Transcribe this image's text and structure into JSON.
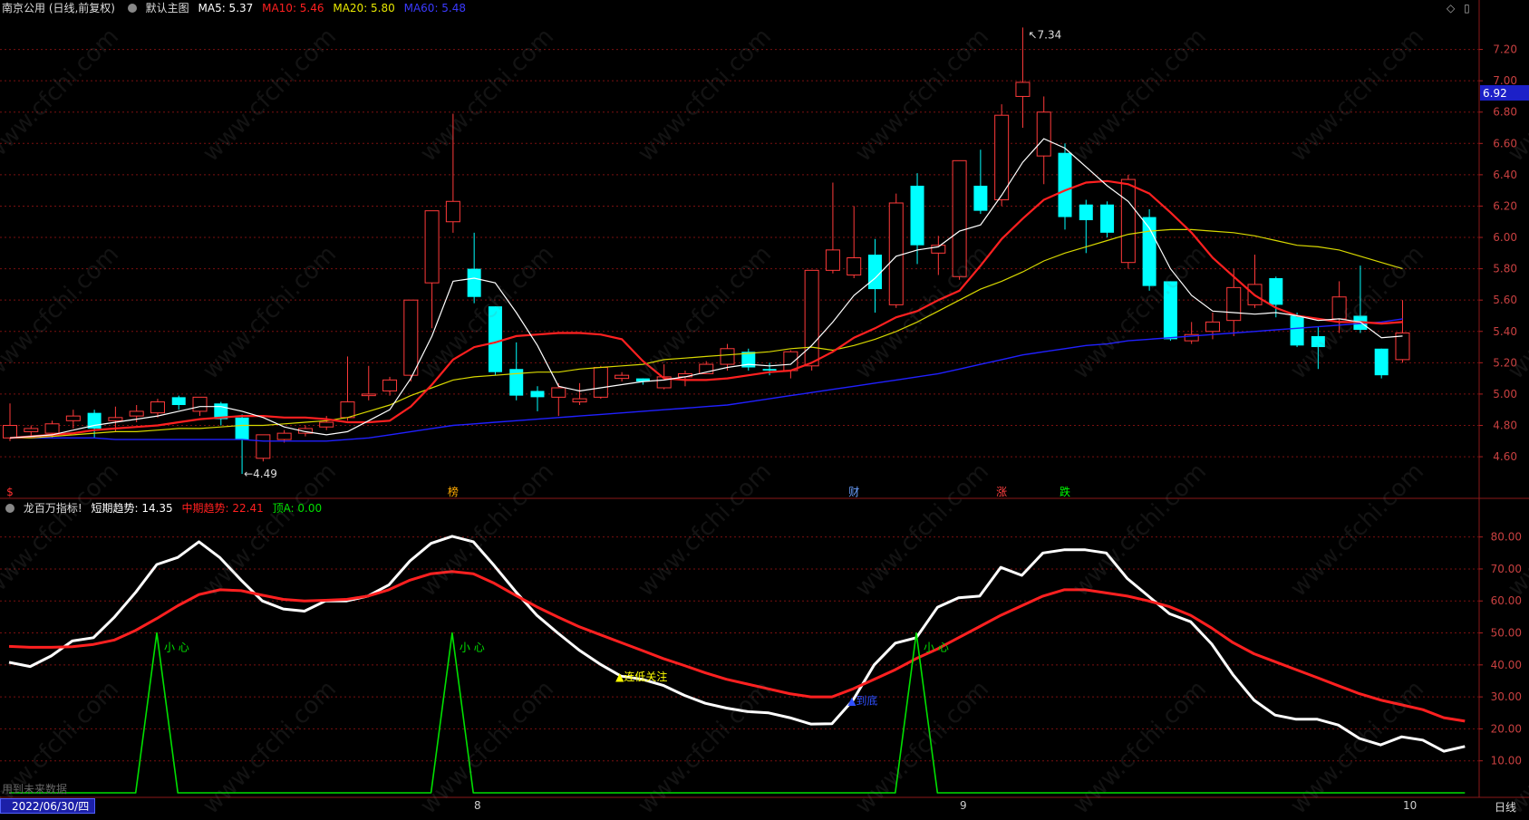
{
  "header": {
    "stock_label": "南京公用 (日线,前复权)",
    "chart_name": "默认主图",
    "ma5": "MA5: 5.37",
    "ma10": "MA10: 5.46",
    "ma20": "MA20: 5.80",
    "ma60": "MA60: 5.48",
    "icon_diamond": "◇",
    "icon_menu": "▯"
  },
  "indicator_header": {
    "name": "龙百万指标!",
    "short": "短期趋势: 14.35",
    "mid": "中期趋势: 22.41",
    "top": "顶A: 0.00"
  },
  "colors": {
    "up": "#ff3a3a",
    "down": "#00ffff",
    "ma5": "#ffffff",
    "ma10": "#ff2020",
    "ma20": "#d8d800",
    "ma60": "#2020ff",
    "grid": "#7a1010",
    "signal": "#00e000"
  },
  "bottom_bar": {
    "date": "2022/06/30/四",
    "month8": "8",
    "month9": "9",
    "month10": "10",
    "period": "日线",
    "future_note": "用到未来数据"
  },
  "watermark": "www.cfchi.com",
  "chart_data": [
    {
      "type": "candlestick",
      "ylim": [
        4.45,
        7.4
      ],
      "y_ticks": [
        "7.20",
        "7.00",
        "6.80",
        "6.60",
        "6.40",
        "6.20",
        "6.00",
        "5.80",
        "5.60",
        "5.40",
        "5.20",
        "5.00",
        "4.80",
        "4.60"
      ],
      "current_price_label": "6.92",
      "high_label": "7.34",
      "low_label": "4.49",
      "event_markers": [
        {
          "index": 0,
          "text": "$",
          "color": "#ff3030"
        },
        {
          "index": 21,
          "text": "榜",
          "color": "#ffaa00"
        },
        {
          "index": 40,
          "text": "财",
          "color": "#6aa0ff"
        },
        {
          "index": 47,
          "text": "涨",
          "color": "#ff4040"
        },
        {
          "index": 50,
          "text": "跌",
          "color": "#00ff00"
        }
      ],
      "candles": [
        {
          "o": 4.72,
          "c": 4.8,
          "h": 4.94,
          "l": 4.7
        },
        {
          "o": 4.76,
          "c": 4.78,
          "h": 4.8,
          "l": 4.73
        },
        {
          "o": 4.75,
          "c": 4.81,
          "h": 4.83,
          "l": 4.72
        },
        {
          "o": 4.83,
          "c": 4.86,
          "h": 4.9,
          "l": 4.78
        },
        {
          "o": 4.88,
          "c": 4.78,
          "h": 4.9,
          "l": 4.72
        },
        {
          "o": 4.83,
          "c": 4.85,
          "h": 4.92,
          "l": 4.76
        },
        {
          "o": 4.86,
          "c": 4.89,
          "h": 4.93,
          "l": 4.82
        },
        {
          "o": 4.88,
          "c": 4.95,
          "h": 4.97,
          "l": 4.85
        },
        {
          "o": 4.98,
          "c": 4.93,
          "h": 4.99,
          "l": 4.9
        },
        {
          "o": 4.89,
          "c": 4.98,
          "h": 4.98,
          "l": 4.86
        },
        {
          "o": 4.94,
          "c": 4.84,
          "h": 4.95,
          "l": 4.8
        },
        {
          "o": 4.85,
          "c": 4.71,
          "h": 4.87,
          "l": 4.49
        },
        {
          "o": 4.59,
          "c": 4.74,
          "h": 4.74,
          "l": 4.57
        },
        {
          "o": 4.71,
          "c": 4.75,
          "h": 4.77,
          "l": 4.69
        },
        {
          "o": 4.75,
          "c": 4.78,
          "h": 4.8,
          "l": 4.73
        },
        {
          "o": 4.79,
          "c": 4.82,
          "h": 4.86,
          "l": 4.77
        },
        {
          "o": 4.85,
          "c": 4.95,
          "h": 5.24,
          "l": 4.83
        },
        {
          "o": 4.99,
          "c": 5.0,
          "h": 5.18,
          "l": 4.96
        },
        {
          "o": 5.02,
          "c": 5.09,
          "h": 5.11,
          "l": 4.99
        },
        {
          "o": 5.12,
          "c": 5.6,
          "h": 5.6,
          "l": 5.08
        },
        {
          "o": 5.71,
          "c": 6.17,
          "h": 6.17,
          "l": 5.42
        },
        {
          "o": 6.1,
          "c": 6.23,
          "h": 6.79,
          "l": 6.03
        },
        {
          "o": 5.8,
          "c": 5.62,
          "h": 6.03,
          "l": 5.58
        },
        {
          "o": 5.56,
          "c": 5.14,
          "h": 5.56,
          "l": 5.12
        },
        {
          "o": 5.16,
          "c": 4.99,
          "h": 5.33,
          "l": 4.96
        },
        {
          "o": 5.02,
          "c": 4.98,
          "h": 5.05,
          "l": 4.89
        },
        {
          "o": 4.98,
          "c": 5.04,
          "h": 5.07,
          "l": 4.86
        },
        {
          "o": 4.95,
          "c": 4.97,
          "h": 5.07,
          "l": 4.93
        },
        {
          "o": 4.98,
          "c": 5.17,
          "h": 5.18,
          "l": 4.97
        },
        {
          "o": 5.1,
          "c": 5.12,
          "h": 5.14,
          "l": 5.08
        },
        {
          "o": 5.1,
          "c": 5.08,
          "h": 5.1,
          "l": 5.06
        },
        {
          "o": 5.04,
          "c": 5.11,
          "h": 5.19,
          "l": 5.03
        },
        {
          "o": 5.11,
          "c": 5.13,
          "h": 5.15,
          "l": 5.05
        },
        {
          "o": 5.13,
          "c": 5.19,
          "h": 5.21,
          "l": 5.13
        },
        {
          "o": 5.19,
          "c": 5.29,
          "h": 5.32,
          "l": 5.15
        },
        {
          "o": 5.27,
          "c": 5.17,
          "h": 5.29,
          "l": 5.15
        },
        {
          "o": 5.16,
          "c": 5.15,
          "h": 5.2,
          "l": 5.12
        },
        {
          "o": 5.15,
          "c": 5.27,
          "h": 5.28,
          "l": 5.1
        },
        {
          "o": 5.18,
          "c": 5.79,
          "h": 5.79,
          "l": 5.15
        },
        {
          "o": 5.79,
          "c": 5.92,
          "h": 6.35,
          "l": 5.77
        },
        {
          "o": 5.76,
          "c": 5.87,
          "h": 6.2,
          "l": 5.74
        },
        {
          "o": 5.89,
          "c": 5.67,
          "h": 5.99,
          "l": 5.52
        },
        {
          "o": 5.57,
          "c": 6.22,
          "h": 6.28,
          "l": 5.55
        },
        {
          "o": 6.33,
          "c": 5.95,
          "h": 6.41,
          "l": 5.83
        },
        {
          "o": 5.9,
          "c": 5.95,
          "h": 6.01,
          "l": 5.76
        },
        {
          "o": 5.75,
          "c": 6.49,
          "h": 6.49,
          "l": 5.73
        },
        {
          "o": 6.33,
          "c": 6.17,
          "h": 6.56,
          "l": 6.15
        },
        {
          "o": 6.24,
          "c": 6.78,
          "h": 6.85,
          "l": 6.2
        },
        {
          "o": 6.9,
          "c": 6.99,
          "h": 7.34,
          "l": 6.7
        },
        {
          "o": 6.52,
          "c": 6.8,
          "h": 6.9,
          "l": 6.34
        },
        {
          "o": 6.54,
          "c": 6.13,
          "h": 6.6,
          "l": 6.05
        },
        {
          "o": 6.21,
          "c": 6.11,
          "h": 6.24,
          "l": 5.9
        },
        {
          "o": 6.21,
          "c": 6.03,
          "h": 6.23,
          "l": 6.0
        },
        {
          "o": 5.84,
          "c": 6.37,
          "h": 6.4,
          "l": 5.8
        },
        {
          "o": 6.13,
          "c": 5.69,
          "h": 6.18,
          "l": 5.66
        },
        {
          "o": 5.72,
          "c": 5.35,
          "h": 5.72,
          "l": 5.34
        },
        {
          "o": 5.34,
          "c": 5.38,
          "h": 5.46,
          "l": 5.32
        },
        {
          "o": 5.4,
          "c": 5.46,
          "h": 5.52,
          "l": 5.35
        },
        {
          "o": 5.47,
          "c": 5.68,
          "h": 5.8,
          "l": 5.37
        },
        {
          "o": 5.57,
          "c": 5.7,
          "h": 5.89,
          "l": 5.55
        },
        {
          "o": 5.74,
          "c": 5.57,
          "h": 5.75,
          "l": 5.49
        },
        {
          "o": 5.5,
          "c": 5.31,
          "h": 5.52,
          "l": 5.3
        },
        {
          "o": 5.37,
          "c": 5.3,
          "h": 5.43,
          "l": 5.16
        },
        {
          "o": 5.48,
          "c": 5.62,
          "h": 5.72,
          "l": 5.39
        },
        {
          "o": 5.5,
          "c": 5.41,
          "h": 5.82,
          "l": 5.39
        },
        {
          "o": 5.29,
          "c": 5.12,
          "h": 5.29,
          "l": 5.1
        },
        {
          "o": 5.22,
          "c": 5.39,
          "h": 5.6,
          "l": 5.2
        }
      ],
      "ma5": [
        4.72,
        4.73,
        4.74,
        4.77,
        4.8,
        4.82,
        4.84,
        4.86,
        4.89,
        4.92,
        4.92,
        4.89,
        4.85,
        4.79,
        4.76,
        4.74,
        4.76,
        4.83,
        4.9,
        5.1,
        5.37,
        5.72,
        5.74,
        5.71,
        5.52,
        5.31,
        5.05,
        5.02,
        5.04,
        5.06,
        5.08,
        5.09,
        5.11,
        5.14,
        5.17,
        5.19,
        5.18,
        5.19,
        5.31,
        5.46,
        5.63,
        5.74,
        5.88,
        5.92,
        5.94,
        6.04,
        6.08,
        6.27,
        6.48,
        6.63,
        6.57,
        6.45,
        6.33,
        6.23,
        6.06,
        5.8,
        5.63,
        5.53,
        5.52,
        5.51,
        5.52,
        5.5,
        5.47,
        5.48,
        5.46,
        5.36,
        5.37
      ],
      "ma10": [
        4.72,
        4.73,
        4.74,
        4.75,
        4.77,
        4.78,
        4.79,
        4.8,
        4.82,
        4.84,
        4.85,
        4.86,
        4.86,
        4.85,
        4.85,
        4.84,
        4.82,
        4.82,
        4.83,
        4.92,
        5.06,
        5.22,
        5.3,
        5.33,
        5.37,
        5.38,
        5.39,
        5.39,
        5.38,
        5.35,
        5.21,
        5.1,
        5.09,
        5.09,
        5.1,
        5.12,
        5.14,
        5.15,
        5.2,
        5.27,
        5.36,
        5.42,
        5.49,
        5.53,
        5.6,
        5.66,
        5.82,
        5.99,
        6.12,
        6.24,
        6.3,
        6.35,
        6.36,
        6.34,
        6.28,
        6.16,
        6.03,
        5.87,
        5.75,
        5.63,
        5.55,
        5.5,
        5.48,
        5.46,
        5.46,
        5.45,
        5.46
      ],
      "ma20": [
        4.72,
        4.72,
        4.73,
        4.74,
        4.75,
        4.76,
        4.76,
        4.77,
        4.78,
        4.78,
        4.79,
        4.8,
        4.8,
        4.81,
        4.82,
        4.83,
        4.85,
        4.89,
        4.93,
        4.99,
        5.04,
        5.09,
        5.11,
        5.12,
        5.13,
        5.14,
        5.14,
        5.16,
        5.17,
        5.18,
        5.19,
        5.22,
        5.23,
        5.24,
        5.25,
        5.26,
        5.27,
        5.29,
        5.3,
        5.28,
        5.31,
        5.35,
        5.4,
        5.46,
        5.53,
        5.6,
        5.67,
        5.72,
        5.78,
        5.85,
        5.9,
        5.94,
        5.98,
        6.02,
        6.04,
        6.05,
        6.05,
        6.04,
        6.03,
        6.01,
        5.98,
        5.95,
        5.94,
        5.92,
        5.88,
        5.84,
        5.8
      ],
      "ma60": [
        4.72,
        4.72,
        4.72,
        4.72,
        4.72,
        4.71,
        4.71,
        4.71,
        4.71,
        4.71,
        4.71,
        4.71,
        4.7,
        4.7,
        4.7,
        4.7,
        4.71,
        4.72,
        4.74,
        4.76,
        4.78,
        4.8,
        4.81,
        4.82,
        4.83,
        4.84,
        4.85,
        4.86,
        4.87,
        4.88,
        4.89,
        4.9,
        4.91,
        4.92,
        4.93,
        4.95,
        4.97,
        4.99,
        5.01,
        5.03,
        5.05,
        5.07,
        5.09,
        5.11,
        5.13,
        5.16,
        5.19,
        5.22,
        5.25,
        5.27,
        5.29,
        5.31,
        5.32,
        5.34,
        5.35,
        5.36,
        5.37,
        5.38,
        5.39,
        5.4,
        5.41,
        5.42,
        5.43,
        5.44,
        5.45,
        5.46,
        5.48
      ]
    },
    {
      "type": "line",
      "ylim": [
        0,
        85
      ],
      "y_ticks": [
        "80.00",
        "70.00",
        "60.00",
        "50.00",
        "40.00",
        "30.00",
        "20.00",
        "10.00"
      ],
      "annotations": [
        {
          "index": 7,
          "text": "小 心",
          "color": "#00e000"
        },
        {
          "index": 21,
          "text": "小 心",
          "color": "#00e000"
        },
        {
          "index": 29,
          "text": "▲连低关注",
          "color": "#ffff00"
        },
        {
          "index": 40,
          "text": "▲到底",
          "color": "#3050ff"
        },
        {
          "index": 43,
          "text": "小 心",
          "color": "#00e000"
        }
      ],
      "series": [
        {
          "name": "短期趋势",
          "color": "#ffffff",
          "values": [
            40.8,
            39.5,
            42.8,
            47.5,
            48.5,
            55,
            62.7,
            71.4,
            73.6,
            78.5,
            73.5,
            66.5,
            60,
            57.5,
            56.8,
            60,
            60,
            61.5,
            65,
            72.5,
            78,
            80.2,
            78.5,
            71,
            63,
            55.6,
            50,
            44.7,
            40.3,
            36.5,
            35.5,
            33.6,
            30.5,
            28,
            26.5,
            25.4,
            25,
            23.5,
            21.5,
            21.6,
            29,
            40,
            46.8,
            48.5,
            58,
            61,
            61.5,
            70.5,
            68,
            75,
            76,
            76,
            75,
            67,
            61.5,
            56,
            53.5,
            46.5,
            37,
            29,
            24.3,
            23,
            23,
            21.2,
            17,
            15,
            17.5,
            16.5,
            13,
            14.5
          ]
        },
        {
          "name": "中期趋势",
          "color": "#ff2020",
          "values": [
            45.8,
            45.5,
            45.5,
            45.7,
            46.4,
            47.8,
            50.8,
            54.5,
            58.5,
            62,
            63.5,
            63.2,
            61.8,
            60.5,
            60,
            60.2,
            60.5,
            61.5,
            63.5,
            66.5,
            68.5,
            69.2,
            68.5,
            65.5,
            61.8,
            58.2,
            55,
            52,
            49.5,
            47,
            44.5,
            42,
            39.8,
            37.5,
            35.5,
            34,
            32.5,
            31,
            30,
            30,
            32.5,
            35.5,
            38.5,
            42,
            45,
            48.5,
            52,
            55.5,
            58.5,
            61.5,
            63.5,
            63.5,
            62.5,
            61.5,
            60,
            58.2,
            55.5,
            51.5,
            47,
            43.5,
            41,
            38.5,
            36,
            33.5,
            31,
            29,
            27.5,
            26,
            23.5,
            22.4
          ]
        },
        {
          "name": "顶A",
          "color": "#00e000",
          "values": [
            0,
            0,
            0,
            0,
            0,
            0,
            0,
            50,
            0,
            0,
            0,
            0,
            0,
            0,
            0,
            0,
            0,
            0,
            0,
            0,
            0,
            50,
            0,
            0,
            0,
            0,
            0,
            0,
            0,
            0,
            0,
            0,
            0,
            0,
            0,
            0,
            0,
            0,
            0,
            0,
            0,
            0,
            0,
            50,
            0,
            0,
            0,
            0,
            0,
            0,
            0,
            0,
            0,
            0,
            0,
            0,
            0,
            0,
            0,
            0,
            0,
            0,
            0,
            0,
            0,
            0,
            0,
            0,
            0,
            0
          ]
        }
      ]
    }
  ]
}
